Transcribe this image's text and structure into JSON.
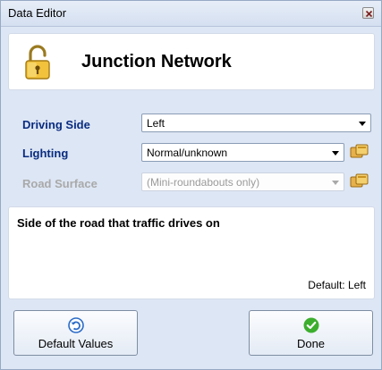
{
  "window": {
    "title": "Data Editor"
  },
  "header": {
    "title": "Junction Network"
  },
  "fields": [
    {
      "label": "Driving Side",
      "value": "Left",
      "enabled": true
    },
    {
      "label": "Lighting",
      "value": "Normal/unknown",
      "enabled": true
    },
    {
      "label": "Road Surface",
      "value": "(Mini-roundabouts only)",
      "enabled": false
    }
  ],
  "description": {
    "text": "Side of the road that traffic drives on",
    "default": "Default: Left"
  },
  "buttons": {
    "defaults_label": "Default Values",
    "done_label": "Done"
  },
  "icons": {
    "header": "unlocked-padlock-icon",
    "lighting_action": "clipboard-paste-icon",
    "surface_action": "clipboard-paste-icon",
    "defaults": "undo-arrow-icon",
    "done": "check-icon",
    "close": "close-icon"
  },
  "colors": {
    "label_accent": "#0a2c80",
    "done_green": "#3cae2e",
    "undo_blue": "#2a6bc8",
    "window_bg": "#dde6f4"
  }
}
